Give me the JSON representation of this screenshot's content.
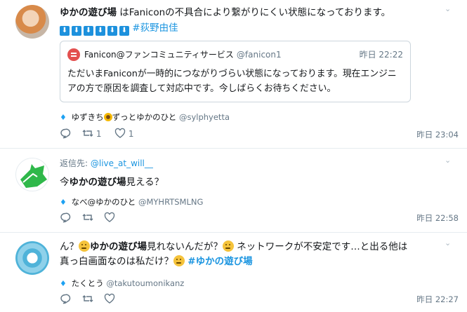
{
  "tweets": [
    {
      "author": "ゆかの遊び場",
      "text_rest": " はFaniconの不具合により繋がりにくい状態になっております。",
      "arrows": [
        "⬇",
        "⬇",
        "⬇",
        "⬇",
        "⬇",
        "⬇"
      ],
      "hashtag": "#荻野由佳",
      "quote": {
        "name": "Fanicon@ファンコミュニティサービス",
        "handle": "@fanicon1",
        "time": "昨日 22:22",
        "text": "ただいまFaniconが一時的につながりづらい状態になっております。現在エンジニアの方で原因を調査して対応中です。今しばらくお待ちください。"
      },
      "rt_user": "ゆずきち",
      "rt_user2": "ずっとゆかのひと",
      "rt_handle": "@sylphyetta",
      "retweets": "1",
      "likes": "1",
      "timestamp": "昨日 23:04"
    },
    {
      "reply_prefix": "返信先: ",
      "reply_handle": "@live_at_will__",
      "text_pre": "今",
      "author": "ゆかの遊び場",
      "text_post": "見える？",
      "rt_user": "なべ@ゆかのひと",
      "rt_handle": "@MYHRTSMLNG",
      "timestamp": "昨日 22:58"
    },
    {
      "text_a": "ん？",
      "author": "ゆかの遊び場",
      "text_b": "見れないんだが？",
      "text_c": " ネットワークが不安定です…と出る他は",
      "text_d": "真っ白画面なのは私だけ？",
      "hashtag": "#ゆかの遊び場",
      "rt_user": "たくとう",
      "rt_handle": "@takutoumonikanz",
      "timestamp": "昨日 22:27"
    }
  ],
  "colors": {
    "accent": "#1da1f2",
    "hashtag": "#1b95e0",
    "muted": "#657786",
    "divider": "#e6ecf0"
  },
  "icons": [
    "chevron-down-icon",
    "reply-icon",
    "retweet-icon",
    "like-icon",
    "twitter-bird-icon",
    "arrow-down-icon",
    "thinking-face-emoji",
    "sunflower-emoji"
  ]
}
